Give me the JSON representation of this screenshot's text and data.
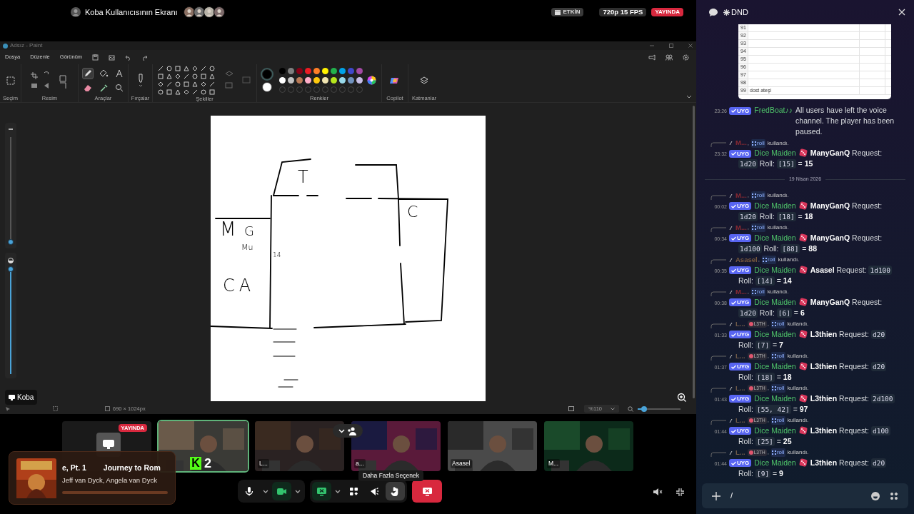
{
  "stream": {
    "title": "Koba Kullanıcısının Ekranı",
    "viewers": [
      {
        "color": "#8a6f62"
      },
      {
        "color": "#6f6f6f"
      },
      {
        "color": "#b8b3a8"
      },
      {
        "color": "#7d6a6a"
      }
    ],
    "badges": [
      {
        "kind": "activity",
        "text": "ETKİN"
      },
      {
        "kind": "quality",
        "text": "720p 15 FPS"
      },
      {
        "kind": "live",
        "text": "YAYINDA"
      }
    ],
    "label": "Koba"
  },
  "paint": {
    "title": "Adsız - Paint",
    "menu": [
      "Dosya",
      "Düzenle",
      "Görünüm"
    ],
    "groups": [
      "Seçim",
      "Resim",
      "Araçlar",
      "Fırçalar",
      "Şekiller",
      "Renkler",
      "Copilot",
      "Katmanlar"
    ],
    "tools": [
      {
        "kind": "pencil",
        "selected": true
      },
      {
        "kind": "fill",
        "selected": false
      },
      {
        "kind": "text",
        "selected": false
      },
      {
        "kind": "eraser",
        "selected": false
      },
      {
        "kind": "picker",
        "selected": false
      },
      {
        "kind": "magnifier",
        "selected": false
      }
    ],
    "current_colors": [
      {
        "color": "#000000",
        "selected": true
      },
      {
        "color": "#ffffff",
        "selected": false
      }
    ],
    "swatches": [
      {
        "color": "#000000"
      },
      {
        "color": "#7f7f7f"
      },
      {
        "color": "#880015"
      },
      {
        "color": "#ed1c24"
      },
      {
        "color": "#ff7f27"
      },
      {
        "color": "#fff200"
      },
      {
        "color": "#22b14c"
      },
      {
        "color": "#00a2e8"
      },
      {
        "color": "#3f48cc"
      },
      {
        "color": "#a349a4"
      },
      {
        "color": "#ffffff"
      },
      {
        "color": "#c3c3c3"
      },
      {
        "color": "#b97a57"
      },
      {
        "color": "#ffaec9"
      },
      {
        "color": "#ffc90e"
      },
      {
        "color": "#efe4b0"
      },
      {
        "color": "#b5e61d"
      },
      {
        "color": "#99d9ea"
      },
      {
        "color": "#7092be"
      },
      {
        "color": "#c8bfe7"
      }
    ],
    "brush_size": {
      "level": 0.02
    },
    "opacity": {
      "level": 0.98
    },
    "canvas_labels": [
      "T",
      "C",
      "M",
      "G",
      "Mu",
      "14",
      "CA"
    ],
    "status": {
      "size": "690 × 1024px",
      "zoom": "%110",
      "zoom_slider": {
        "level": 0.15
      }
    }
  },
  "participants": [
    {
      "kind": "screen",
      "live_badge": "YAYINDA",
      "selected": false
    },
    {
      "kind": "camera",
      "selected": true,
      "overlay_logo": "K",
      "overlay_count": "2"
    },
    {
      "kind": "camera",
      "label": "L...",
      "selected": false
    },
    {
      "kind": "camera",
      "label": "a...",
      "selected": false
    },
    {
      "kind": "camera",
      "label": "Asasel",
      "selected": false
    },
    {
      "kind": "camera",
      "label": "M...",
      "selected": false
    }
  ],
  "music": {
    "title_parts": [
      "e, Pt. 1",
      "Journey to Rom"
    ],
    "artist": "Jeff van Dyck, Angela van Dyck",
    "level": 0
  },
  "controls": [
    {
      "kind": "mic",
      "active": false,
      "hovered": false
    },
    {
      "kind": "mic_menu",
      "active": false,
      "hovered": false
    },
    {
      "kind": "camera",
      "active": true,
      "hovered": false
    },
    {
      "kind": "camera_menu",
      "active": false,
      "hovered": false
    },
    {
      "kind": "screen",
      "active": true,
      "hovered": false
    },
    {
      "kind": "screen_menu",
      "active": false,
      "hovered": false
    },
    {
      "kind": "apps",
      "active": false,
      "hovered": false
    },
    {
      "kind": "soundboard",
      "active": false,
      "hovered": false
    },
    {
      "kind": "more",
      "active": false,
      "hovered": true,
      "tooltip": "Daha Fazla Seçenek"
    },
    {
      "kind": "end"
    }
  ],
  "participants_toggle": {
    "expanded": true
  },
  "chat": {
    "channel": "DND",
    "embed": {
      "rows": [
        {
          "number": "91"
        },
        {
          "number": "92"
        },
        {
          "number": "93"
        },
        {
          "number": "94"
        },
        {
          "number": "95"
        },
        {
          "number": "96"
        },
        {
          "number": "97"
        },
        {
          "number": "98"
        },
        {
          "number": "99",
          "cell": "dost ateşi"
        }
      ]
    },
    "items": [
      {
        "kind": "message",
        "time": "23:26",
        "badge": "UYG",
        "author": "FredBoat♪♪",
        "content": [
          {
            "kind": "text",
            "text": "All users have left the voice channel. The player has been paused."
          }
        ]
      },
      {
        "kind": "message",
        "reply": {
          "user": "M...",
          "color": "#8b2a33",
          "separator": ",",
          "command": "roll",
          "suffix": "kullandı."
        },
        "time": "23:32",
        "badge": "UYG",
        "author": "Dice Maiden",
        "content": [
          {
            "kind": "dice"
          },
          {
            "kind": "bold",
            "text": "ManyGanQ"
          },
          {
            "kind": "text",
            "text": "Request:"
          },
          {
            "kind": "code",
            "text": "1d20"
          },
          {
            "kind": "text",
            "text": "Roll:"
          },
          {
            "kind": "code",
            "text": "[15]"
          },
          {
            "kind": "text",
            "text": "="
          },
          {
            "kind": "bold",
            "text": "15"
          }
        ]
      },
      {
        "kind": "divider",
        "text": "19 Nisan 2026"
      },
      {
        "kind": "message",
        "reply": {
          "user": "M...",
          "color": "#8b2a33",
          "separator": ",",
          "command": "roll",
          "suffix": "kullandı."
        },
        "time": "00:02",
        "badge": "UYG",
        "author": "Dice Maiden",
        "content": [
          {
            "kind": "dice"
          },
          {
            "kind": "bold",
            "text": "ManyGanQ"
          },
          {
            "kind": "text",
            "text": "Request:"
          },
          {
            "kind": "code",
            "text": "1d20"
          },
          {
            "kind": "text",
            "text": "Roll:"
          },
          {
            "kind": "code",
            "text": "[18]"
          },
          {
            "kind": "text",
            "text": "="
          },
          {
            "kind": "bold",
            "text": "18"
          }
        ]
      },
      {
        "kind": "message",
        "reply": {
          "user": "M...",
          "color": "#8b2a33",
          "separator": ",",
          "command": "roll",
          "suffix": "kullandı."
        },
        "time": "00:34",
        "badge": "UYG",
        "author": "Dice Maiden",
        "content": [
          {
            "kind": "dice"
          },
          {
            "kind": "bold",
            "text": "ManyGanQ"
          },
          {
            "kind": "text",
            "text": "Request:"
          },
          {
            "kind": "code",
            "text": "1d100"
          },
          {
            "kind": "text",
            "text": "Roll:"
          },
          {
            "kind": "code",
            "text": "[88]"
          },
          {
            "kind": "text",
            "text": "="
          },
          {
            "kind": "bold",
            "text": "88"
          }
        ]
      },
      {
        "kind": "message",
        "reply": {
          "user": "Asasel",
          "color": "#7a5a3e",
          "separator": ",",
          "command": "roll",
          "suffix": "kullandı."
        },
        "time": "00:35",
        "badge": "UYG",
        "author": "Dice Maiden",
        "content": [
          {
            "kind": "dice"
          },
          {
            "kind": "bold",
            "text": "Asasel"
          },
          {
            "kind": "text",
            "text": "Request:"
          },
          {
            "kind": "code",
            "text": "1d100"
          },
          {
            "kind": "text",
            "text": "Roll:"
          },
          {
            "kind": "code",
            "text": "[14]"
          },
          {
            "kind": "text",
            "text": "="
          },
          {
            "kind": "bold",
            "text": "14"
          }
        ]
      },
      {
        "kind": "message",
        "reply": {
          "user": "M...",
          "color": "#8b2a33",
          "separator": ",",
          "command": "roll",
          "suffix": "kullandı."
        },
        "time": "00:38",
        "badge": "UYG",
        "author": "Dice Maiden",
        "content": [
          {
            "kind": "dice"
          },
          {
            "kind": "bold",
            "text": "ManyGanQ"
          },
          {
            "kind": "text",
            "text": "Request:"
          },
          {
            "kind": "code",
            "text": "1d20"
          },
          {
            "kind": "text",
            "text": "Roll:"
          },
          {
            "kind": "code",
            "text": "[6]"
          },
          {
            "kind": "text",
            "text": "="
          },
          {
            "kind": "bold",
            "text": "6"
          }
        ]
      },
      {
        "kind": "message",
        "reply": {
          "user": "L...",
          "color": "#6e5a48",
          "tag": "L3TH",
          "separator": ",",
          "command": "roll",
          "suffix": "kullandı."
        },
        "time": "01:33",
        "badge": "UYG",
        "author": "Dice Maiden",
        "content": [
          {
            "kind": "dice"
          },
          {
            "kind": "bold",
            "text": "L3thien"
          },
          {
            "kind": "text",
            "text": "Request:"
          },
          {
            "kind": "code",
            "text": "d20"
          },
          {
            "kind": "text",
            "text": "Roll:"
          },
          {
            "kind": "code",
            "text": "[7]"
          },
          {
            "kind": "text",
            "text": "="
          },
          {
            "kind": "bold",
            "text": "7"
          }
        ]
      },
      {
        "kind": "message",
        "reply": {
          "user": "L...",
          "color": "#6e5a48",
          "tag": "L3TH",
          "separator": ",",
          "command": "roll",
          "suffix": "kullandı."
        },
        "time": "01:37",
        "badge": "UYG",
        "author": "Dice Maiden",
        "content": [
          {
            "kind": "dice"
          },
          {
            "kind": "bold",
            "text": "L3thien"
          },
          {
            "kind": "text",
            "text": "Request:"
          },
          {
            "kind": "code",
            "text": "d20"
          },
          {
            "kind": "text",
            "text": "Roll:"
          },
          {
            "kind": "code",
            "text": "[18]"
          },
          {
            "kind": "text",
            "text": "="
          },
          {
            "kind": "bold",
            "text": "18"
          }
        ]
      },
      {
        "kind": "message",
        "reply": {
          "user": "L...",
          "color": "#6e5a48",
          "tag": "L3TH",
          "separator": ",",
          "command": "roll",
          "suffix": "kullandı."
        },
        "time": "01:43",
        "badge": "UYG",
        "author": "Dice Maiden",
        "content": [
          {
            "kind": "dice"
          },
          {
            "kind": "bold",
            "text": "L3thien"
          },
          {
            "kind": "text",
            "text": "Request:"
          },
          {
            "kind": "code",
            "text": "2d100"
          },
          {
            "kind": "text",
            "text": "Roll:"
          },
          {
            "kind": "code",
            "text": "[55, 42]"
          },
          {
            "kind": "text",
            "text": "="
          },
          {
            "kind": "bold",
            "text": "97"
          }
        ]
      },
      {
        "kind": "message",
        "reply": {
          "user": "L...",
          "color": "#6e5a48",
          "tag": "L3TH",
          "separator": ",",
          "command": "roll",
          "suffix": "kullandı."
        },
        "time": "01:44",
        "badge": "UYG",
        "author": "Dice Maiden",
        "content": [
          {
            "kind": "dice"
          },
          {
            "kind": "bold",
            "text": "L3thien"
          },
          {
            "kind": "text",
            "text": "Request:"
          },
          {
            "kind": "code",
            "text": "d100"
          },
          {
            "kind": "text",
            "text": "Roll:"
          },
          {
            "kind": "code",
            "text": "[25]"
          },
          {
            "kind": "text",
            "text": "="
          },
          {
            "kind": "bold",
            "text": "25"
          }
        ]
      },
      {
        "kind": "message",
        "reply": {
          "user": "L...",
          "color": "#6e5a48",
          "tag": "L3TH",
          "separator": ",",
          "command": "roll",
          "suffix": "kullandı."
        },
        "time": "01:44",
        "badge": "UYG",
        "author": "Dice Maiden",
        "content": [
          {
            "kind": "dice"
          },
          {
            "kind": "bold",
            "text": "L3thien"
          },
          {
            "kind": "text",
            "text": "Request:"
          },
          {
            "kind": "code",
            "text": "d20"
          },
          {
            "kind": "text",
            "text": "Roll:"
          },
          {
            "kind": "code",
            "text": "[9]"
          },
          {
            "kind": "text",
            "text": "="
          },
          {
            "kind": "bold",
            "text": "9"
          }
        ]
      }
    ],
    "composer": {
      "value": "/"
    }
  }
}
